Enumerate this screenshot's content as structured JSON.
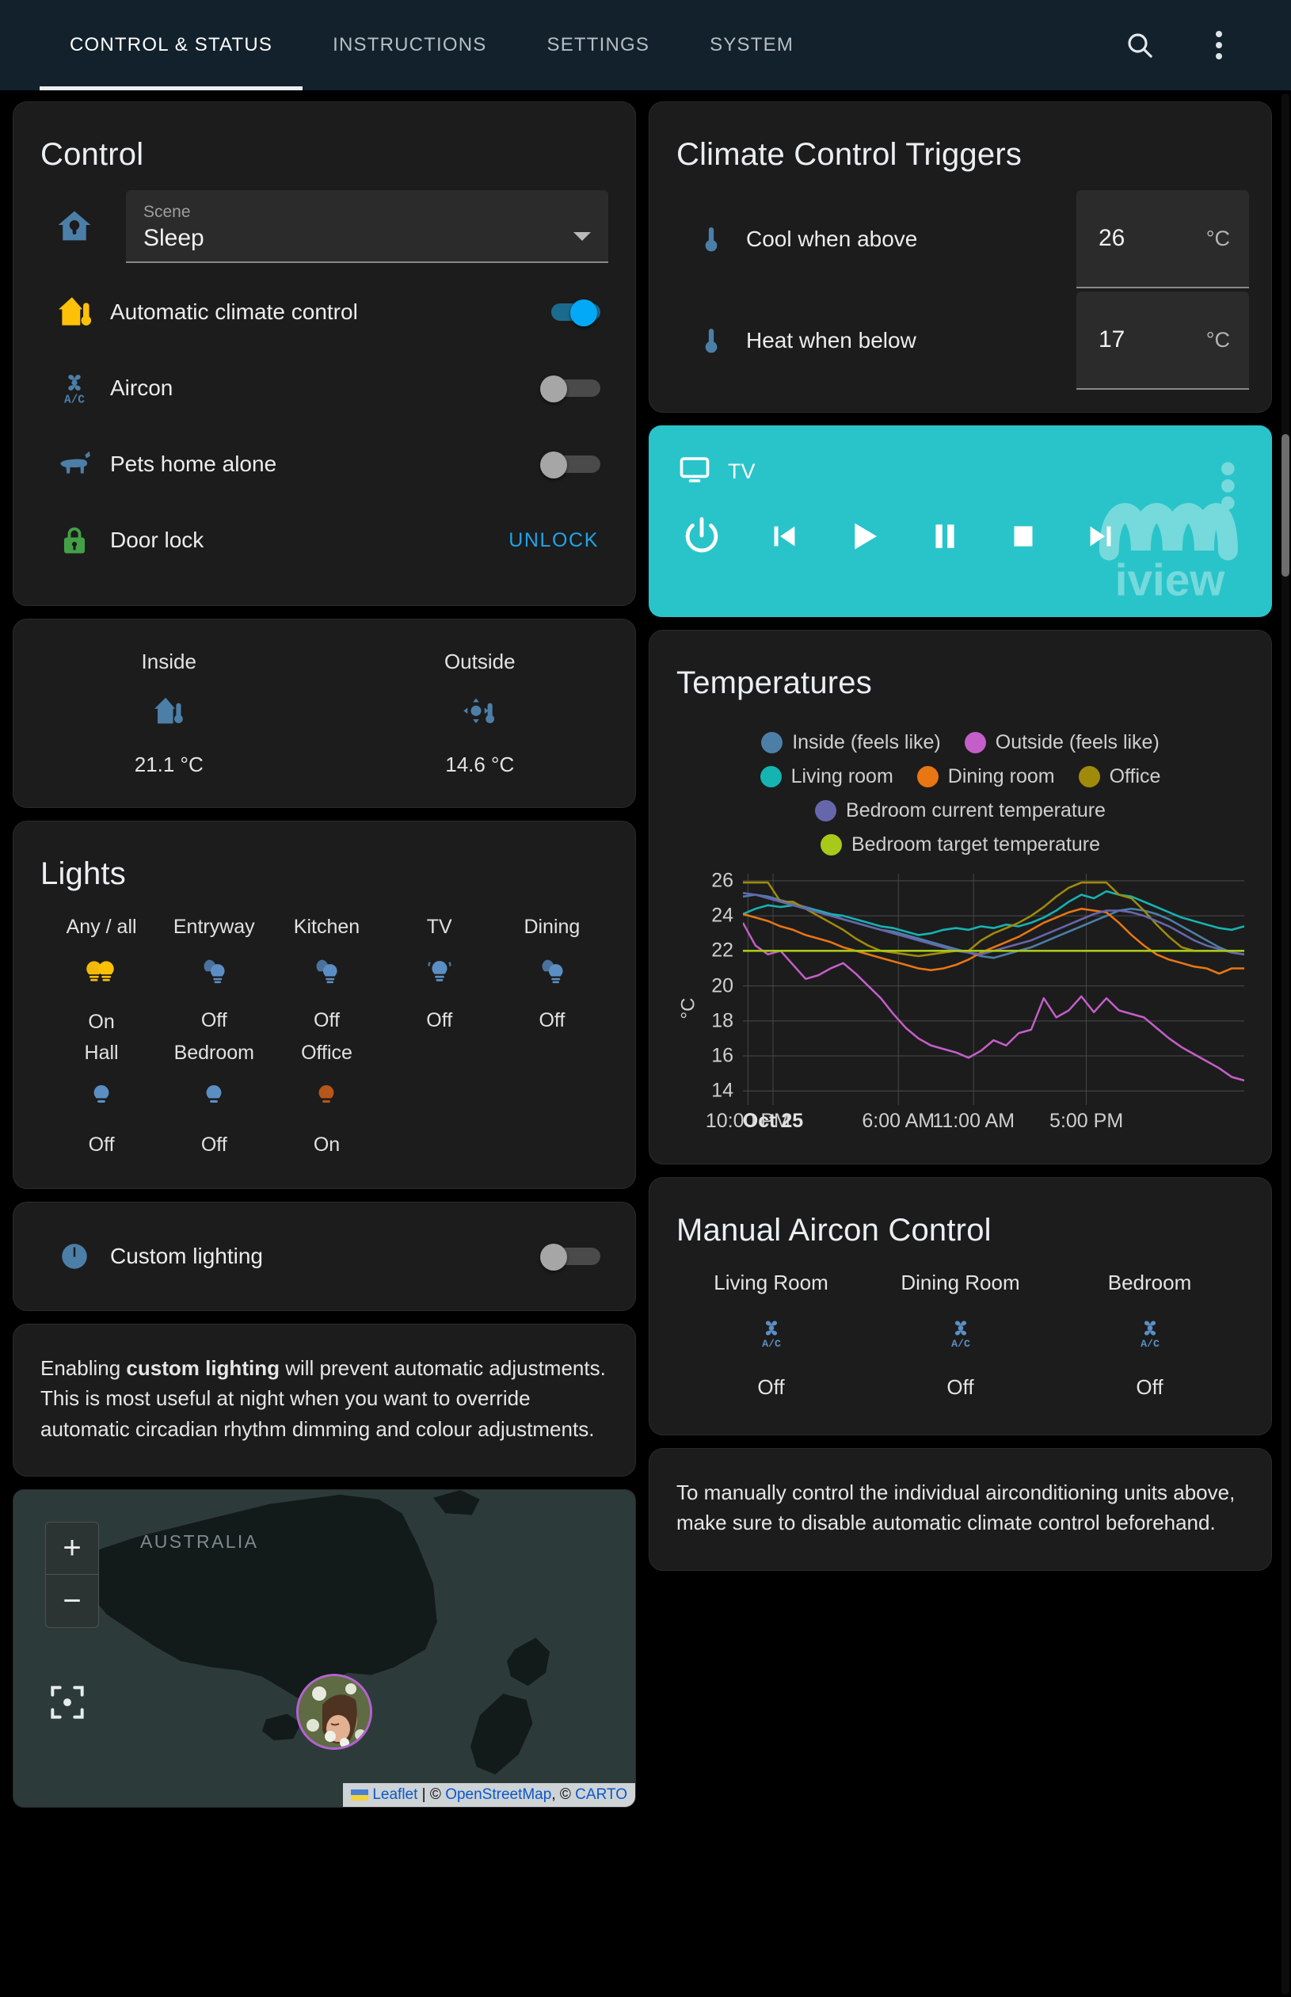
{
  "appbar": {
    "tabs": [
      {
        "label": "CONTROL & STATUS",
        "active": true
      },
      {
        "label": "INSTRUCTIONS",
        "active": false
      },
      {
        "label": "SETTINGS",
        "active": false
      },
      {
        "label": "SYSTEM",
        "active": false
      }
    ],
    "search_icon": "search-icon",
    "menu_icon": "overflow-menu-icon"
  },
  "control": {
    "title": "Control",
    "scene": {
      "label": "Scene",
      "value": "Sleep",
      "icon": "home-lightbulb-icon"
    },
    "rows": [
      {
        "label": "Automatic climate control",
        "icon": "home-thermometer-icon",
        "state": "on",
        "control": "toggle"
      },
      {
        "label": "Aircon",
        "icon": "air-conditioner-icon",
        "state": "off",
        "control": "toggle"
      },
      {
        "label": "Pets home alone",
        "icon": "dog-icon",
        "state": "off",
        "control": "toggle"
      },
      {
        "label": "Door lock",
        "icon": "lock-icon",
        "state": "locked",
        "control": "button",
        "action_label": "UNLOCK"
      }
    ]
  },
  "inside_outside": {
    "cells": [
      {
        "name": "Inside",
        "icon": "home-thermometer-icon",
        "value": "21.1 °C"
      },
      {
        "name": "Outside",
        "icon": "sun-thermometer-icon",
        "value": "14.6 °C"
      }
    ]
  },
  "lights": {
    "title": "Lights",
    "items": [
      {
        "name": "Any / all",
        "state": "On",
        "icon": "lightbulb-group-on-icon",
        "color": "#ffc107"
      },
      {
        "name": "Entryway",
        "state": "Off",
        "icon": "lightbulb-group-off-icon",
        "color": "#5b8fc4"
      },
      {
        "name": "Kitchen",
        "state": "Off",
        "icon": "lightbulb-group-off-icon",
        "color": "#5b8fc4"
      },
      {
        "name": "TV",
        "state": "Off",
        "icon": "lightbulb-multiple-off-icon",
        "color": "#5b8fc4"
      },
      {
        "name": "Dining",
        "state": "Off",
        "icon": "lightbulb-group-off-icon",
        "color": "#5b8fc4"
      },
      {
        "name": "Hall",
        "state": "Off",
        "icon": "lightbulb-off-icon",
        "color": "#5b8fc4"
      },
      {
        "name": "Bedroom",
        "state": "Off",
        "icon": "lightbulb-off-icon",
        "color": "#5b8fc4"
      },
      {
        "name": "Office",
        "state": "On",
        "icon": "lightbulb-on-icon",
        "color": "#b5561b"
      }
    ]
  },
  "custom_lighting": {
    "label": "Custom lighting",
    "icon": "timer-icon",
    "state": "off"
  },
  "lighting_note": {
    "prefix": "Enabling ",
    "bold": "custom lighting",
    "suffix": " will prevent automatic adjustments. This is most useful at night when you want to override automatic circadian rhythm dimming and colour adjustments."
  },
  "map": {
    "region_label": "AUSTRALIA",
    "zoom_in": "+",
    "zoom_out": "−",
    "locate_icon": "crosshairs-gps-icon",
    "avatar_icon": "person-avatar",
    "attribution": {
      "leaflet": "Leaflet",
      "separator": " | ",
      "copy1": "© ",
      "osm": "OpenStreetMap",
      "comma": ", ",
      "copy2": "© ",
      "carto": "CARTO"
    }
  },
  "climate_triggers": {
    "title": "Climate Control Triggers",
    "rows": [
      {
        "label": "Cool when above",
        "icon": "thermometer-icon",
        "value": "26",
        "unit": "°C"
      },
      {
        "label": "Heat when below",
        "icon": "thermometer-icon",
        "value": "17",
        "unit": "°C"
      }
    ]
  },
  "tv": {
    "title": "TV",
    "device_icon": "television-icon",
    "brand": "iview",
    "accent": "#29c4c9",
    "controls": [
      {
        "name": "power-button",
        "glyph": "power"
      },
      {
        "name": "previous-track-button",
        "glyph": "prev"
      },
      {
        "name": "play-button",
        "glyph": "play"
      },
      {
        "name": "pause-button",
        "glyph": "pause"
      },
      {
        "name": "stop-button",
        "glyph": "stop"
      },
      {
        "name": "next-track-button",
        "glyph": "next"
      }
    ]
  },
  "temperatures": {
    "title": "Temperatures"
  },
  "chart_data": {
    "type": "line",
    "title": "Temperatures",
    "xlabel": "",
    "ylabel": "°C",
    "ylim": [
      13.2,
      26.4
    ],
    "yticks": [
      14,
      16,
      18,
      20,
      22,
      24,
      26
    ],
    "grid": true,
    "legend_position": "top",
    "x_tick_labels": [
      "10:00 PM",
      "Oct 25",
      "6:00 AM",
      "11:00 AM",
      "5:00 PM"
    ],
    "x_tick_positions": [
      0.01,
      0.06,
      0.31,
      0.46,
      0.685
    ],
    "series": [
      {
        "name": "Inside (feels like)",
        "color": "#4c7fa8",
        "values": [
          25.1,
          25.2,
          25.1,
          24.9,
          24.7,
          24.5,
          24.3,
          24.1,
          23.8,
          23.6,
          23.4,
          23.2,
          23.1,
          22.9,
          22.7,
          22.5,
          22.3,
          22.1,
          21.9,
          21.7,
          21.6,
          21.8,
          22.0,
          22.2,
          22.5,
          22.8,
          23.1,
          23.4,
          23.7,
          24.0,
          24.3,
          24.4,
          24.3,
          24.1,
          23.8,
          23.4,
          23.0,
          22.6,
          22.2,
          21.9,
          21.8
        ]
      },
      {
        "name": "Outside (feels like)",
        "color": "#c45fc9",
        "values": [
          23.6,
          22.3,
          21.8,
          22.0,
          21.2,
          20.4,
          20.6,
          21.0,
          21.3,
          20.7,
          20.0,
          19.3,
          18.4,
          17.6,
          17.0,
          16.6,
          16.4,
          16.2,
          15.9,
          16.3,
          16.9,
          16.6,
          17.3,
          17.5,
          19.3,
          18.2,
          18.6,
          19.4,
          18.5,
          19.3,
          18.6,
          18.4,
          18.2,
          17.6,
          17.0,
          16.5,
          16.1,
          15.7,
          15.3,
          14.8,
          14.6
        ]
      },
      {
        "name": "Living room",
        "color": "#16b3b3",
        "values": [
          24.1,
          24.4,
          24.6,
          24.5,
          24.6,
          24.4,
          24.3,
          24.1,
          24.0,
          23.8,
          23.6,
          23.4,
          23.3,
          23.1,
          22.9,
          23.0,
          23.2,
          23.3,
          23.2,
          23.4,
          23.3,
          23.5,
          23.4,
          23.6,
          23.9,
          24.3,
          24.8,
          25.2,
          25.0,
          25.4,
          25.2,
          25.1,
          24.8,
          24.5,
          24.2,
          23.9,
          23.7,
          23.5,
          23.3,
          23.2,
          23.4
        ]
      },
      {
        "name": "Dining room",
        "color": "#e87613",
        "values": [
          24.1,
          23.9,
          23.7,
          23.4,
          23.2,
          22.9,
          22.7,
          22.5,
          22.2,
          22.0,
          21.8,
          21.6,
          21.4,
          21.2,
          21.0,
          20.9,
          21.0,
          21.2,
          21.5,
          21.9,
          22.2,
          22.5,
          22.8,
          23.2,
          23.6,
          23.9,
          24.2,
          24.4,
          24.3,
          24.2,
          23.6,
          22.9,
          22.3,
          21.8,
          21.5,
          21.3,
          21.1,
          21.0,
          20.7,
          21.0,
          21.0
        ]
      },
      {
        "name": "Office",
        "color": "#a08a0b",
        "values": [
          25.9,
          25.9,
          25.9,
          24.8,
          24.8,
          24.4,
          24.0,
          23.6,
          23.2,
          22.7,
          22.3,
          22.0,
          21.9,
          21.8,
          21.7,
          21.8,
          21.9,
          22.0,
          22.0,
          22.6,
          23.0,
          23.3,
          23.6,
          24.0,
          24.5,
          25.1,
          25.6,
          25.9,
          25.9,
          25.9,
          25.2,
          25.0,
          24.3,
          23.5,
          22.8,
          22.2,
          22.0,
          22.0,
          22.0,
          22.0,
          22.0
        ]
      },
      {
        "name": "Bedroom current temperature",
        "color": "#6667ab",
        "values": [
          25.3,
          25.2,
          25.0,
          24.8,
          24.6,
          24.4,
          24.2,
          24.0,
          23.8,
          23.6,
          23.4,
          23.2,
          23.0,
          22.8,
          22.6,
          22.4,
          22.2,
          22.0,
          21.9,
          21.8,
          22.0,
          22.2,
          22.4,
          22.6,
          22.9,
          23.2,
          23.5,
          23.8,
          24.1,
          24.3,
          24.3,
          24.2,
          24.0,
          23.7,
          23.4,
          23.0,
          22.6,
          22.3,
          22.1,
          21.9,
          21.8
        ]
      },
      {
        "name": "Bedroom target temperature",
        "color": "#a8c91a",
        "values": [
          22,
          22,
          22,
          22,
          22,
          22,
          22,
          22,
          22,
          22,
          22,
          22,
          22,
          22,
          22,
          22,
          22,
          22,
          22,
          22,
          22,
          22,
          22,
          22,
          22,
          22,
          22,
          22,
          22,
          22,
          22,
          22,
          22,
          22,
          22,
          22,
          22,
          22,
          22,
          22,
          22
        ]
      }
    ]
  },
  "manual_aircon": {
    "title": "Manual Aircon Control",
    "units": [
      {
        "name": "Living Room",
        "icon": "air-conditioner-icon",
        "state": "Off"
      },
      {
        "name": "Dining Room",
        "icon": "air-conditioner-icon",
        "state": "Off"
      },
      {
        "name": "Bedroom",
        "icon": "air-conditioner-icon",
        "state": "Off"
      }
    ]
  },
  "aircon_note": {
    "text": "To manually control the individual airconditioning units above, make sure to disable automatic climate control beforehand."
  }
}
